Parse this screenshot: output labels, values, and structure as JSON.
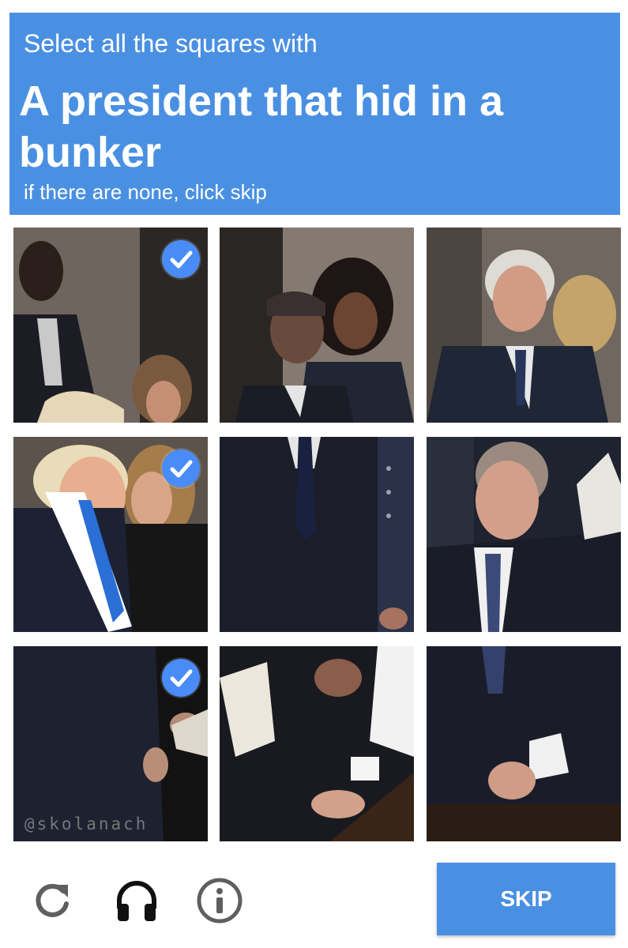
{
  "header": {
    "lead": "Select all the squares with",
    "target": "A president that hid in a bunker",
    "hint": "if there are none, click skip"
  },
  "tiles": [
    {
      "row": 0,
      "col": 0,
      "selected": true
    },
    {
      "row": 0,
      "col": 1,
      "selected": false
    },
    {
      "row": 0,
      "col": 2,
      "selected": false
    },
    {
      "row": 1,
      "col": 0,
      "selected": true
    },
    {
      "row": 1,
      "col": 1,
      "selected": false
    },
    {
      "row": 1,
      "col": 2,
      "selected": false
    },
    {
      "row": 2,
      "col": 0,
      "selected": true
    },
    {
      "row": 2,
      "col": 1,
      "selected": false
    },
    {
      "row": 2,
      "col": 2,
      "selected": false
    }
  ],
  "watermark": "@skolanach",
  "footer": {
    "icons": [
      "reload-icon",
      "headphones-icon",
      "info-icon"
    ],
    "skip_label": "SKIP"
  },
  "colors": {
    "header_bg": "#4a90e2",
    "check_bg": "#4a8cf7",
    "skip_bg": "#4a90e2"
  }
}
